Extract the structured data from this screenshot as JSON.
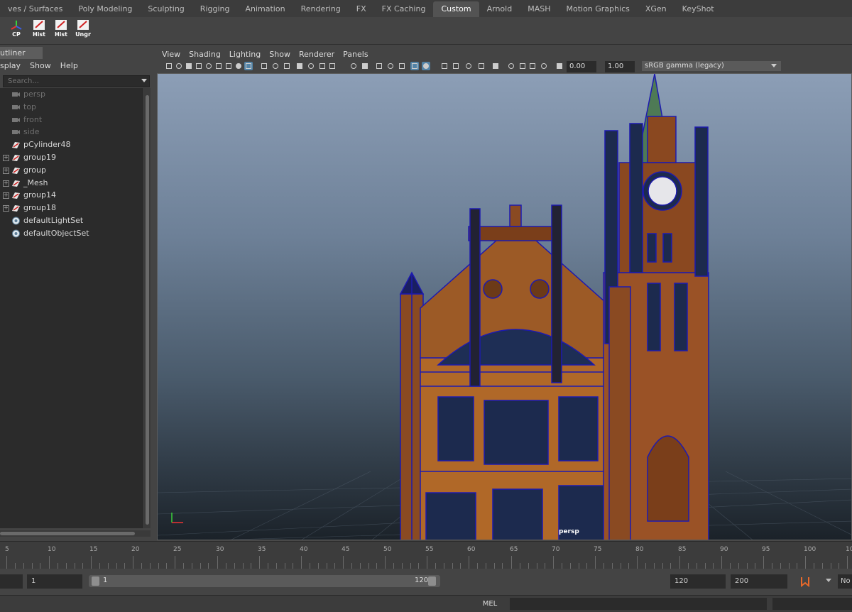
{
  "shelf_tabs": [
    "ves / Surfaces",
    "Poly Modeling",
    "Sculpting",
    "Rigging",
    "Animation",
    "Rendering",
    "FX",
    "FX Caching",
    "Custom",
    "Arnold",
    "MASH",
    "Motion Graphics",
    "XGen",
    "KeyShot"
  ],
  "active_shelf_tab": "Custom",
  "shelf_buttons": [
    "CP",
    "Hist",
    "Hist",
    "Ungr"
  ],
  "outliner": {
    "title": "utliner",
    "menu": [
      "splay",
      "Show",
      "Help"
    ],
    "search_placeholder": "Search...",
    "items": [
      {
        "name": "persp",
        "type": "camera",
        "expandable": false,
        "dim": true
      },
      {
        "name": "top",
        "type": "camera",
        "expandable": false,
        "dim": true
      },
      {
        "name": "front",
        "type": "camera",
        "expandable": false,
        "dim": true
      },
      {
        "name": "side",
        "type": "camera",
        "expandable": false,
        "dim": true
      },
      {
        "name": "pCylinder48",
        "type": "mesh",
        "expandable": false,
        "dim": false
      },
      {
        "name": "group19",
        "type": "mesh",
        "expandable": true,
        "dim": false
      },
      {
        "name": "group",
        "type": "mesh",
        "expandable": true,
        "dim": false
      },
      {
        "name": "_Mesh",
        "type": "mesh",
        "expandable": true,
        "dim": false
      },
      {
        "name": "group14",
        "type": "mesh",
        "expandable": true,
        "dim": false
      },
      {
        "name": "group18",
        "type": "mesh",
        "expandable": true,
        "dim": false
      },
      {
        "name": "defaultLightSet",
        "type": "set",
        "expandable": false,
        "dim": false
      },
      {
        "name": "defaultObjectSet",
        "type": "set",
        "expandable": false,
        "dim": false
      }
    ]
  },
  "panel": {
    "menu": [
      "View",
      "Shading",
      "Lighting",
      "Show",
      "Renderer",
      "Panels"
    ],
    "exposure": "0.00",
    "gamma": "1.00",
    "color_space": "sRGB gamma (legacy)",
    "camera": "persp"
  },
  "timeline": {
    "ticks": [
      "5",
      "10",
      "15",
      "20",
      "25",
      "30",
      "35",
      "40",
      "45",
      "50",
      "55",
      "60",
      "65",
      "70",
      "75",
      "80",
      "85",
      "90",
      "95",
      "100",
      "10"
    ]
  },
  "range": {
    "start": "1",
    "slider_start": "1",
    "slider_end": "120",
    "end": "120",
    "anim_end": "200",
    "right_label": "No"
  },
  "command": {
    "language": "MEL"
  },
  "colors": {
    "accent": "#5383a6",
    "wire": "#1d1ab0",
    "brick": "#8f4b22"
  }
}
